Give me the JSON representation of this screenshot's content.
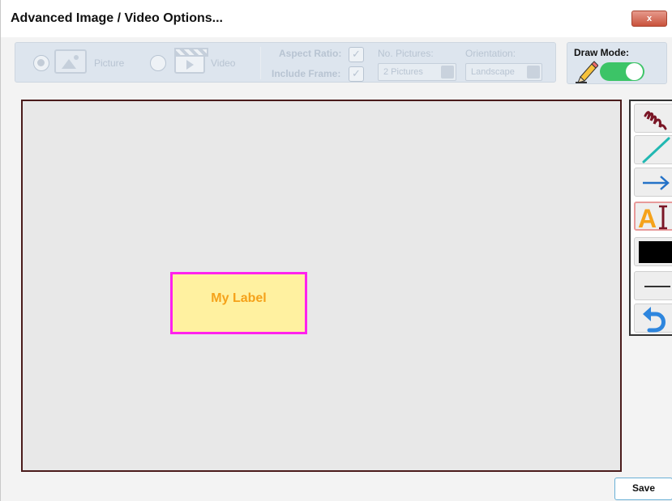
{
  "window": {
    "title": "Advanced Image / Video Options...",
    "close_label": "x"
  },
  "options": {
    "media": [
      {
        "label": "Picture",
        "selected": true,
        "icon": "picture-icon"
      },
      {
        "label": "Video",
        "selected": false,
        "icon": "video-icon"
      }
    ],
    "aspect_ratio_label": "Aspect Ratio:",
    "aspect_ratio_checked": true,
    "include_frame_label": "Include Frame:",
    "include_frame_checked": true,
    "no_pictures_label": "No. Pictures:",
    "no_pictures_value": "2 Pictures",
    "orientation_label": "Orientation:",
    "orientation_value": "Landscape",
    "disabled_color": "#b8c4d2"
  },
  "draw_mode": {
    "label": "Draw Mode:",
    "enabled": true,
    "toggle_color": "#3cc467"
  },
  "canvas": {
    "background": "#e8e8e8",
    "label_text": "My Label",
    "label_fill": "#fff1a0",
    "label_border": "#ff22ee",
    "label_color": "#f5a21a"
  },
  "tools": [
    {
      "name": "freehand-tool",
      "icon": "scribble-icon"
    },
    {
      "name": "line-tool",
      "icon": "diagonal-line-icon"
    },
    {
      "name": "arrow-tool",
      "icon": "arrow-right-icon"
    },
    {
      "name": "text-tool",
      "icon": "text-cursor-icon",
      "active": true
    },
    {
      "name": "color-tool",
      "icon": "color-swatch-icon"
    },
    {
      "name": "line-width-tool",
      "icon": "line-width-icon"
    },
    {
      "name": "undo-tool",
      "icon": "undo-icon"
    }
  ],
  "footer": {
    "save_label": "Save"
  }
}
